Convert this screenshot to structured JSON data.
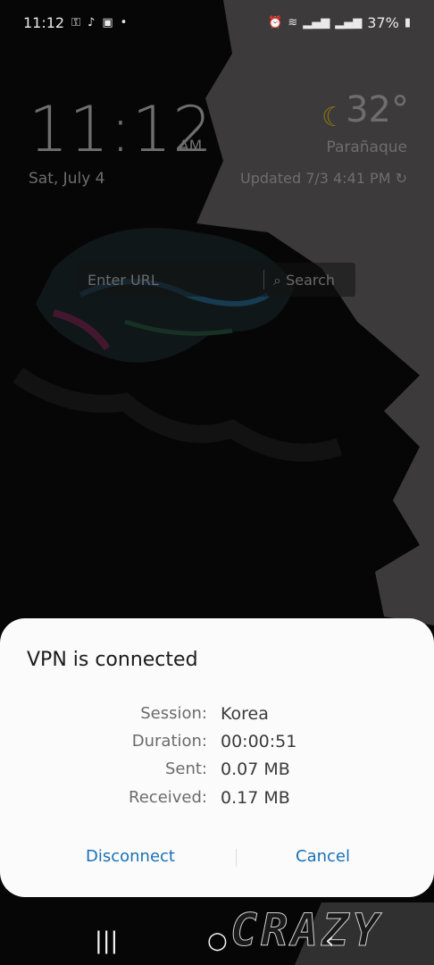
{
  "status_bar": {
    "time": "11:12",
    "battery": "37%",
    "left_icons": [
      "key-icon",
      "tiktok-icon",
      "shop-icon",
      "dot-icon"
    ],
    "right_icons": [
      "alarm-icon",
      "wifi-icon",
      "signal-icon",
      "signal-icon",
      "battery-icon"
    ]
  },
  "lockscreen": {
    "clock": "11:12",
    "ampm": "AM",
    "date": "Sat, July 4",
    "weather": {
      "icon": "moon-icon",
      "temperature": "32°",
      "city": "Parañaque",
      "updated": "Updated 7/3 4:41 PM"
    },
    "url_bar": {
      "placeholder": "Enter URL",
      "search_label": "Search"
    },
    "wallpaper_text": "CRAZY"
  },
  "vpn_dialog": {
    "title": "VPN is connected",
    "rows": [
      {
        "label": "Session:",
        "value": "Korea"
      },
      {
        "label": "Duration:",
        "value": "00:00:51"
      },
      {
        "label": "Sent:",
        "value": "0.07 MB"
      },
      {
        "label": "Received:",
        "value": "0.17 MB"
      }
    ],
    "disconnect_label": "Disconnect",
    "cancel_label": "Cancel",
    "accent_color": "#1a70b5"
  },
  "nav_bar": {
    "icons": [
      "recents-icon",
      "home-icon",
      "back-icon"
    ]
  }
}
